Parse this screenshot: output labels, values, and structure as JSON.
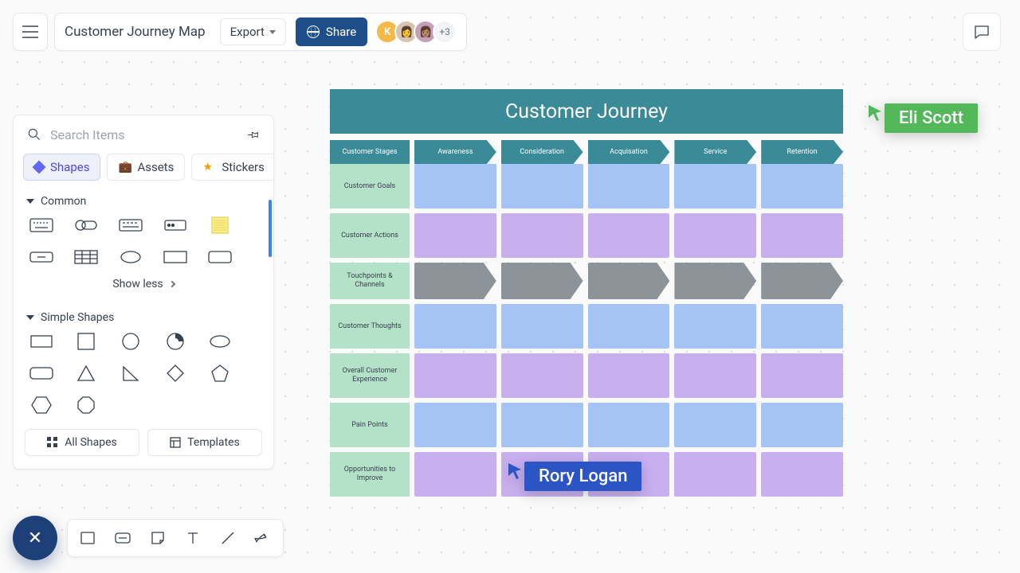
{
  "doc_title": "Customer Journey Map",
  "toolbar": {
    "export": "Export",
    "share": "Share",
    "avatar_count": "+3"
  },
  "search": {
    "placeholder": "Search Items"
  },
  "tabs": {
    "shapes": "Shapes",
    "assets": "Assets",
    "stickers": "Stickers"
  },
  "sections": {
    "common": "Common",
    "simple": "Simple Shapes",
    "show_less": "Show less"
  },
  "buttons": {
    "all_shapes": "All Shapes",
    "templates": "Templates"
  },
  "journey": {
    "title": "Customer Journey",
    "stage_label": "Customer Stages",
    "stages": [
      "Awareness",
      "Consideration",
      "Acquisation",
      "Service",
      "Retention"
    ],
    "rows": [
      {
        "label": "Customer Goals",
        "color": "blue"
      },
      {
        "label": "Customer Actions",
        "color": "purple"
      },
      {
        "label": "Touchpoints & Channels",
        "color": "arrow"
      },
      {
        "label": "Customer Thoughts",
        "color": "blue"
      },
      {
        "label": "Overall Customer Experience",
        "color": "purple"
      },
      {
        "label": "Pain Points",
        "color": "blue"
      },
      {
        "label": "Opportunities to Improve",
        "color": "purple"
      }
    ]
  },
  "cursors": {
    "eli": "Eli Scott",
    "rory": "Rory Logan"
  },
  "colors": {
    "eli": "#52b85a",
    "rory": "#2b54c4"
  }
}
